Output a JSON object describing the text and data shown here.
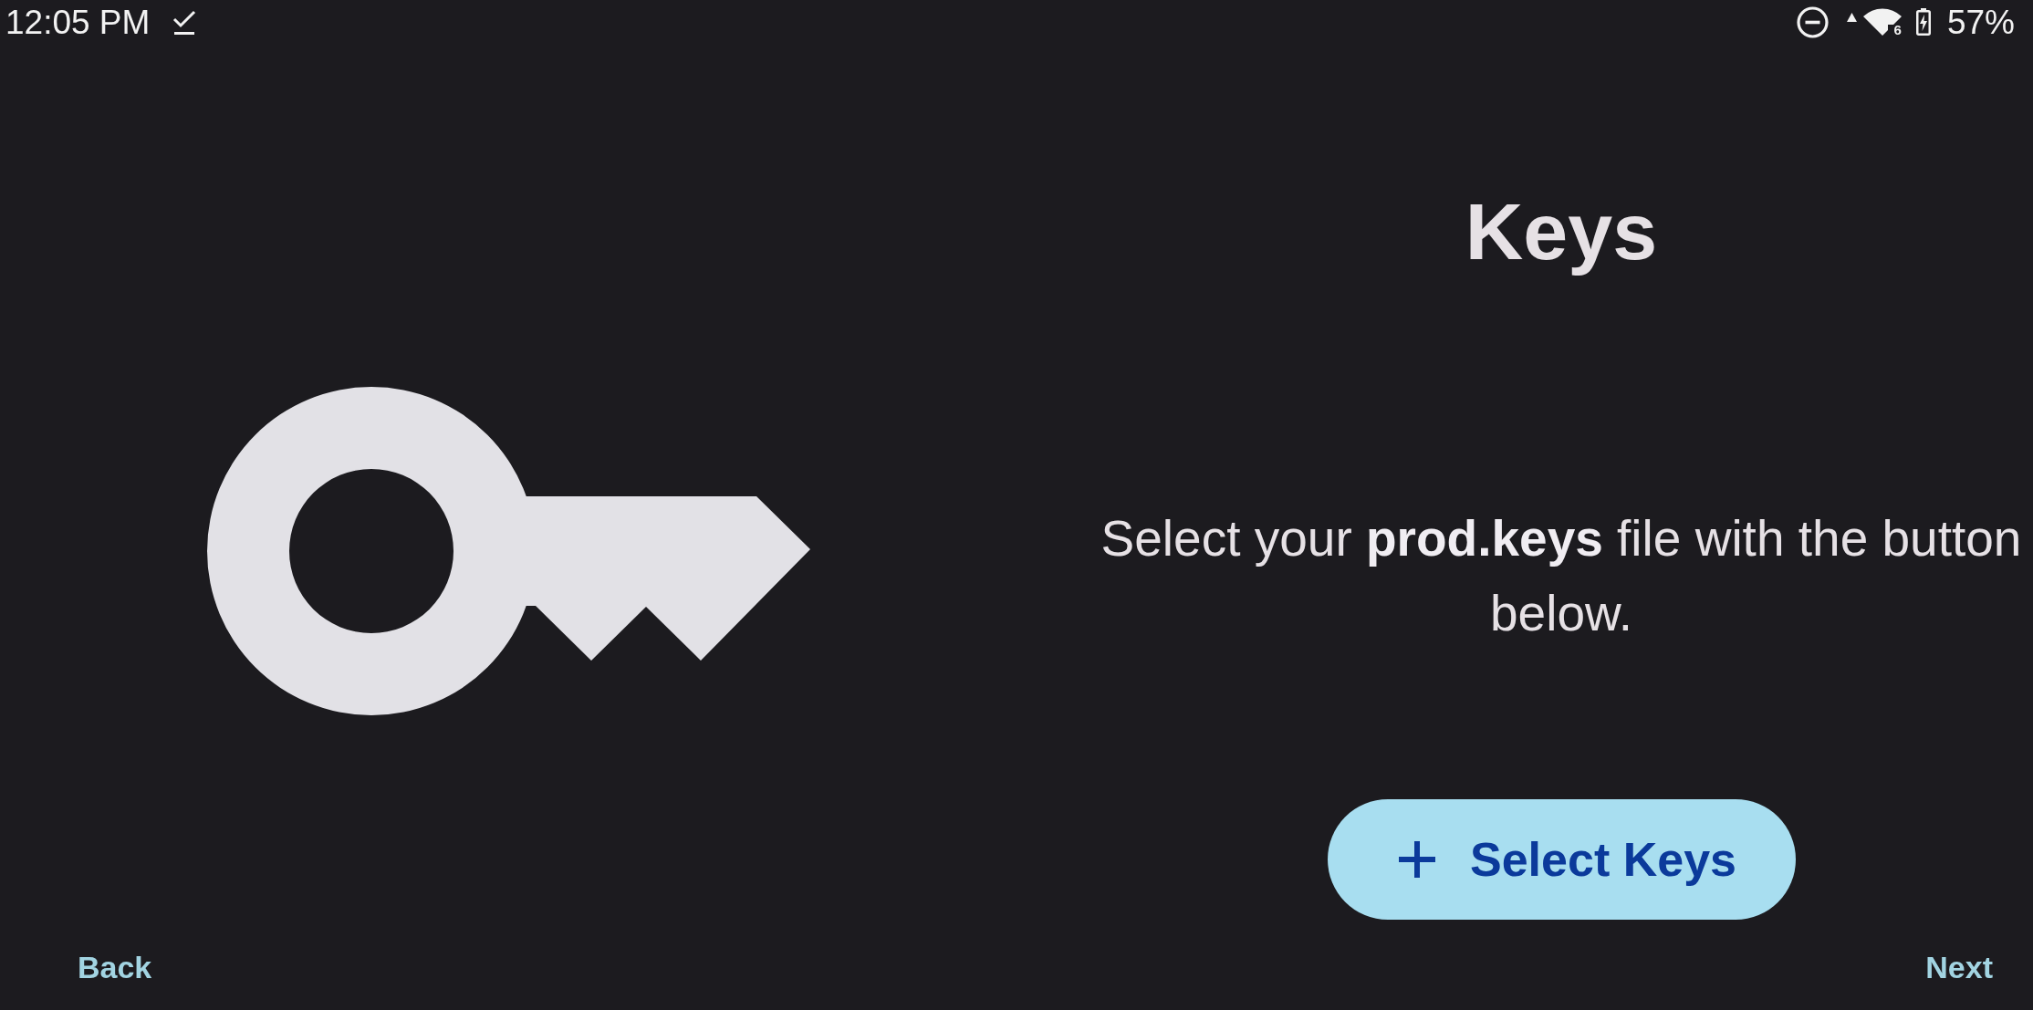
{
  "status_bar": {
    "time": "12:05 PM",
    "wifi_label": "6",
    "battery_charging": true,
    "battery_percent": "57%"
  },
  "page": {
    "title": "Keys",
    "description": "Select your **prod.keys** file with the button below.",
    "action_button": {
      "label": "Select Keys"
    }
  },
  "navigation": {
    "back": "Back",
    "next": "Next"
  }
}
